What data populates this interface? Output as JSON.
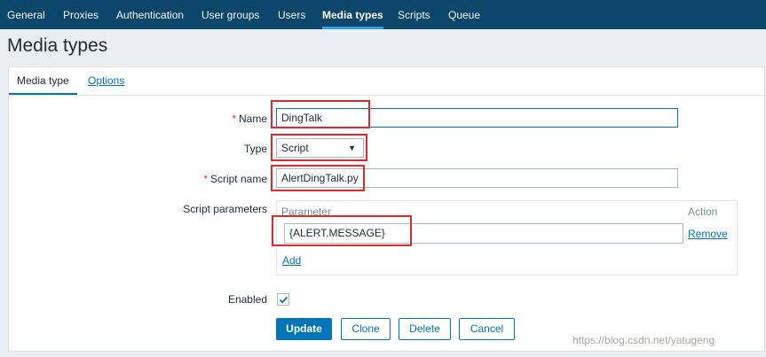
{
  "nav": {
    "items": [
      {
        "label": "General"
      },
      {
        "label": "Proxies"
      },
      {
        "label": "Authentication"
      },
      {
        "label": "User groups"
      },
      {
        "label": "Users"
      },
      {
        "label": "Media types"
      },
      {
        "label": "Scripts"
      },
      {
        "label": "Queue"
      }
    ],
    "active": "Media types"
  },
  "page": {
    "title": "Media types"
  },
  "tabs": {
    "media_type": "Media type",
    "options": "Options"
  },
  "form": {
    "required_marker": "*",
    "name": {
      "label": "Name",
      "value": "DingTalk"
    },
    "type": {
      "label": "Type",
      "value": "Script"
    },
    "script_name": {
      "label": "Script name",
      "value": "AlertDingTalk.py"
    },
    "script_parameters": {
      "label": "Script parameters",
      "header_parameter": "Parameter",
      "header_action": "Action",
      "rows": [
        {
          "value": "{ALERT.MESSAGE}",
          "action": "Remove"
        }
      ],
      "add_label": "Add"
    },
    "enabled": {
      "label": "Enabled",
      "checked": true
    }
  },
  "buttons": {
    "update": "Update",
    "clone": "Clone",
    "delete": "Delete",
    "cancel": "Cancel"
  },
  "watermark": "https://blog.csdn.net/yatugeng",
  "colors": {
    "nav_bg": "#0a466a",
    "accent": "#0275b8",
    "highlight_box": "#e0292b",
    "required": "#e33734"
  }
}
